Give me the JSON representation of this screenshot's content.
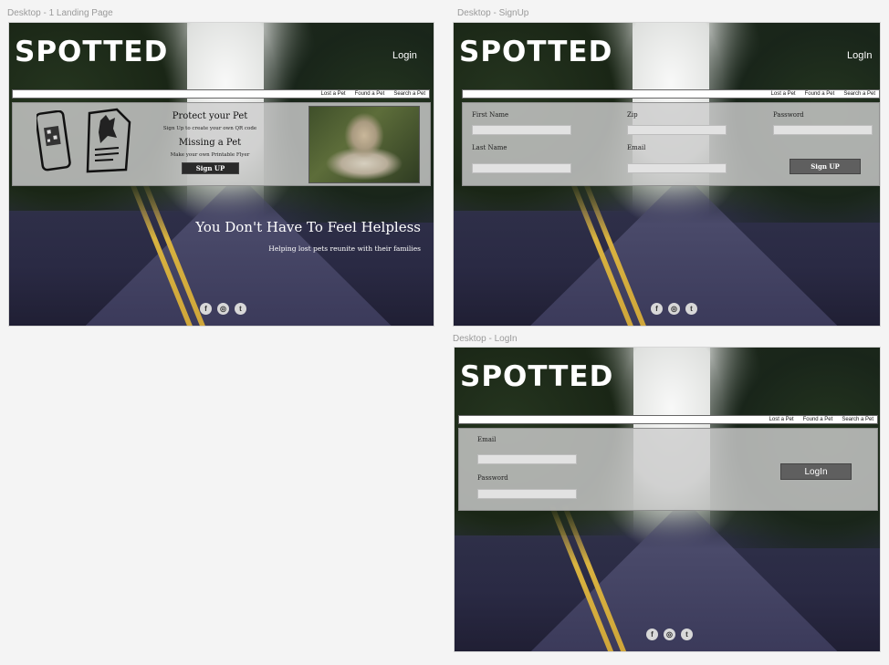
{
  "frames": {
    "landing": {
      "label": "Desktop - 1 Landing Page"
    },
    "signup": {
      "label": "Desktop - SignUp"
    },
    "login": {
      "label": "Desktop - LogIn"
    }
  },
  "brand": {
    "logo": "SPOTTED"
  },
  "nav": {
    "lost": "Lost a Pet",
    "found": "Found a Pet",
    "search": "Search a Pet"
  },
  "landing": {
    "login_link": "Login",
    "protect_title": "Protect your Pet",
    "protect_sub": "Sign Up  to create your own QR code",
    "missing_title": "Missing a Pet",
    "missing_sub": "Make your own Printable Flyer",
    "signup_button": "Sign UP",
    "headline": "You Don't Have To Feel Helpless",
    "subheadline": "Helping  lost pets reunite with their families"
  },
  "signup": {
    "login_link": "LogIn",
    "first_name": "First Name",
    "last_name": "Last Name",
    "zip": "Zip",
    "email": "Email",
    "password": "Password",
    "button": "Sign UP"
  },
  "login": {
    "email": "Email",
    "password": "Password",
    "button": "LogIn"
  },
  "social": {
    "facebook": "f",
    "instagram": "◎",
    "twitter": "t"
  }
}
